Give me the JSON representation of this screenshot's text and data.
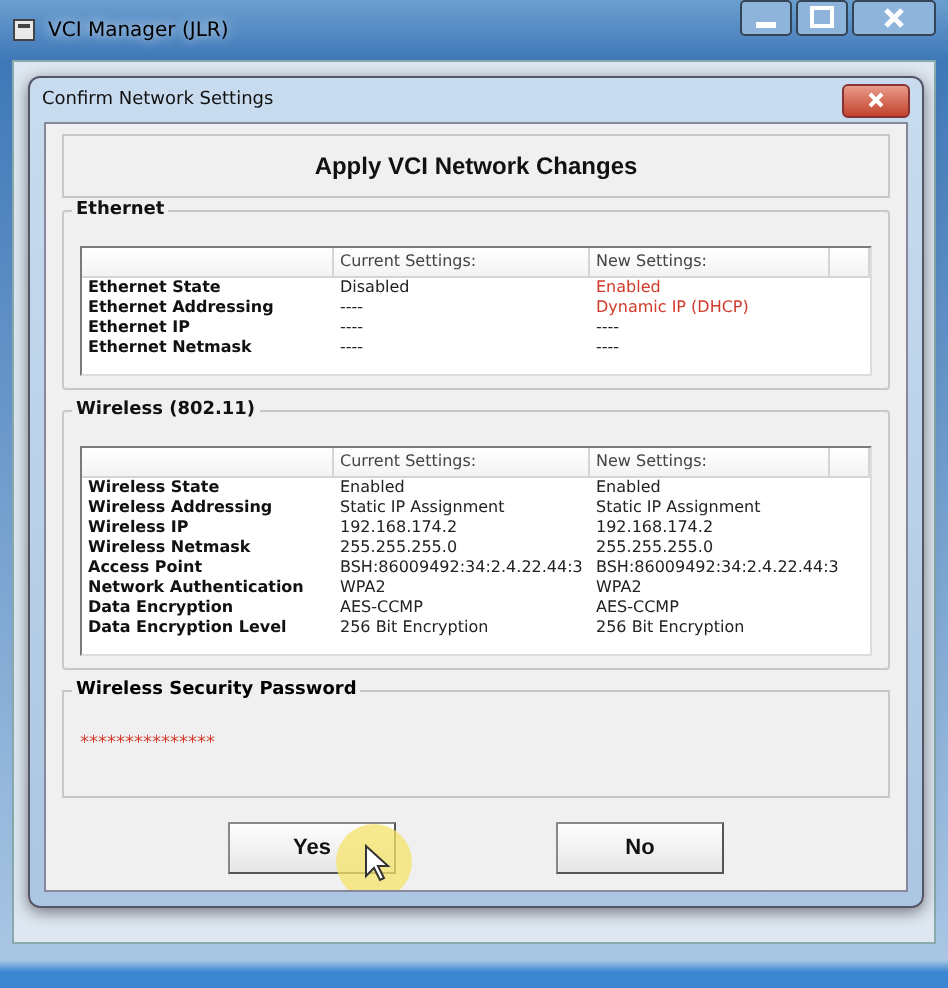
{
  "window": {
    "title": "VCI Manager (JLR)"
  },
  "dialog": {
    "title": "Confirm Network Settings",
    "heading": "Apply VCI Network Changes",
    "sections": [
      {
        "title": "Ethernet",
        "columns": [
          "Current Settings:",
          "New Settings:"
        ],
        "rows": [
          {
            "label": "Ethernet State",
            "current": "Disabled",
            "new": "Enabled",
            "changed": true
          },
          {
            "label": "Ethernet Addressing",
            "current": "----",
            "new": "Dynamic IP (DHCP)",
            "changed": true
          },
          {
            "label": "Ethernet IP",
            "current": "----",
            "new": "----",
            "changed": false
          },
          {
            "label": "Ethernet Netmask",
            "current": "----",
            "new": "----",
            "changed": false
          }
        ]
      },
      {
        "title": "Wireless (802.11)",
        "columns": [
          "Current Settings:",
          "New Settings:"
        ],
        "rows": [
          {
            "label": "Wireless State",
            "current": "Enabled",
            "new": "Enabled",
            "changed": false
          },
          {
            "label": "Wireless Addressing",
            "current": "Static IP Assignment",
            "new": "Static IP Assignment",
            "changed": false
          },
          {
            "label": "Wireless IP",
            "current": "192.168.174.2",
            "new": "192.168.174.2",
            "changed": false
          },
          {
            "label": "Wireless Netmask",
            "current": "255.255.255.0",
            "new": "255.255.255.0",
            "changed": false
          },
          {
            "label": "Access Point",
            "current": "BSH:86009492:34:2.4.22.44:3",
            "new": "BSH:86009492:34:2.4.22.44:3",
            "changed": false
          },
          {
            "label": "Network Authentication",
            "current": "WPA2",
            "new": "WPA2",
            "changed": false
          },
          {
            "label": "Data Encryption",
            "current": "AES-CCMP",
            "new": "AES-CCMP",
            "changed": false
          },
          {
            "label": "Data Encryption Level",
            "current": "256 Bit Encryption",
            "new": "256 Bit Encryption",
            "changed": false
          }
        ]
      }
    ],
    "password": {
      "title": "Wireless Security Password",
      "value": "***************"
    },
    "buttons": [
      {
        "label": "Yes"
      },
      {
        "label": "No"
      }
    ]
  }
}
